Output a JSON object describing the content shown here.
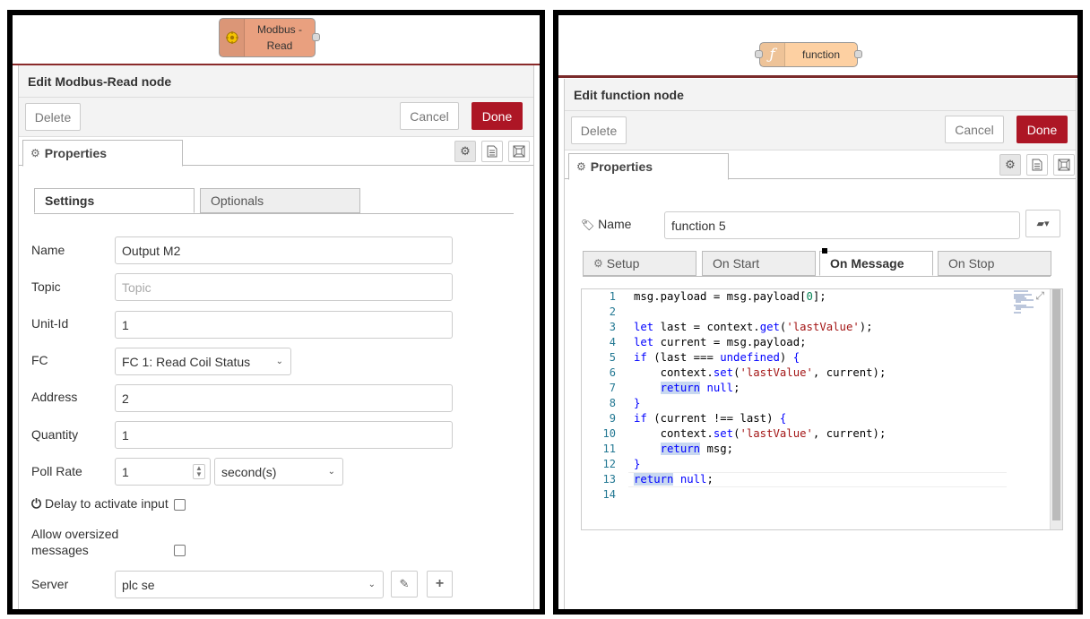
{
  "left": {
    "node": {
      "label_line1": "Modbus -",
      "label_line2": "Read",
      "color": "#e9a07f",
      "icon": "modbus-icon"
    },
    "tray": {
      "title": "Edit Modbus-Read node",
      "delete_label": "Delete",
      "cancel_label": "Cancel",
      "done_label": "Done",
      "properties_tab": "Properties"
    },
    "subtabs": {
      "settings": "Settings",
      "optionals": "Optionals"
    },
    "form": {
      "name_label": "Name",
      "name_value": "Output M2",
      "topic_label": "Topic",
      "topic_placeholder": "Topic",
      "unitid_label": "Unit-Id",
      "unitid_value": "1",
      "fc_label": "FC",
      "fc_value": "FC 1: Read Coil Status",
      "address_label": "Address",
      "address_value": "2",
      "quantity_label": "Quantity",
      "quantity_value": "1",
      "pollrate_label": "Poll Rate",
      "pollrate_value": "1",
      "pollrate_unit": "second(s)",
      "delay_label": "Delay to activate input",
      "oversized_label_line1": "Allow oversized",
      "oversized_label_line2": "messages",
      "server_label": "Server",
      "server_value": "plc se"
    }
  },
  "right": {
    "node": {
      "label": "function",
      "color": "#fdd0a2",
      "icon": "function-icon"
    },
    "tray": {
      "title": "Edit function node",
      "delete_label": "Delete",
      "cancel_label": "Cancel",
      "done_label": "Done",
      "properties_tab": "Properties"
    },
    "name_label": "Name",
    "name_value": "function 5",
    "subtabs": {
      "setup": "Setup",
      "on_start": "On Start",
      "on_message": "On Message",
      "on_stop": "On Stop"
    },
    "code_lines": [
      {
        "n": "1",
        "html": "msg.payload = msg.payload[<span class=\"num\">0</span>];"
      },
      {
        "n": "2",
        "html": ""
      },
      {
        "n": "3",
        "html": "<span class=\"kw\">let</span> last = context.<span class=\"kw\">get</span>(<span class=\"str\">'lastValue'</span>);"
      },
      {
        "n": "4",
        "html": "<span class=\"kw\">let</span> current = msg.payload;"
      },
      {
        "n": "5",
        "html": "<span class=\"kw\">if</span> (last === <span class=\"kw\">undefined</span>) <span class=\"kw\">{</span>"
      },
      {
        "n": "6",
        "html": "    context.<span class=\"kw\">set</span>(<span class=\"str\">'lastValue'</span>, current);"
      },
      {
        "n": "7",
        "html": "    <span class=\"kw hl\">return</span> <span class=\"kw\">null</span>;"
      },
      {
        "n": "8",
        "html": "<span class=\"kw\">}</span>"
      },
      {
        "n": "9",
        "html": "<span class=\"kw\">if</span> (current !== last) <span class=\"kw\">{</span>"
      },
      {
        "n": "10",
        "html": "    context.<span class=\"kw\">set</span>(<span class=\"str\">'lastValue'</span>, current);"
      },
      {
        "n": "11",
        "html": "    <span class=\"kw hl\">return</span> msg;"
      },
      {
        "n": "12",
        "html": "<span class=\"kw\">}</span>"
      },
      {
        "n": "13",
        "html": "<span class=\"kw hl\">return</span> <span class=\"kw\">null</span>;"
      },
      {
        "n": "14",
        "html": ""
      }
    ]
  }
}
